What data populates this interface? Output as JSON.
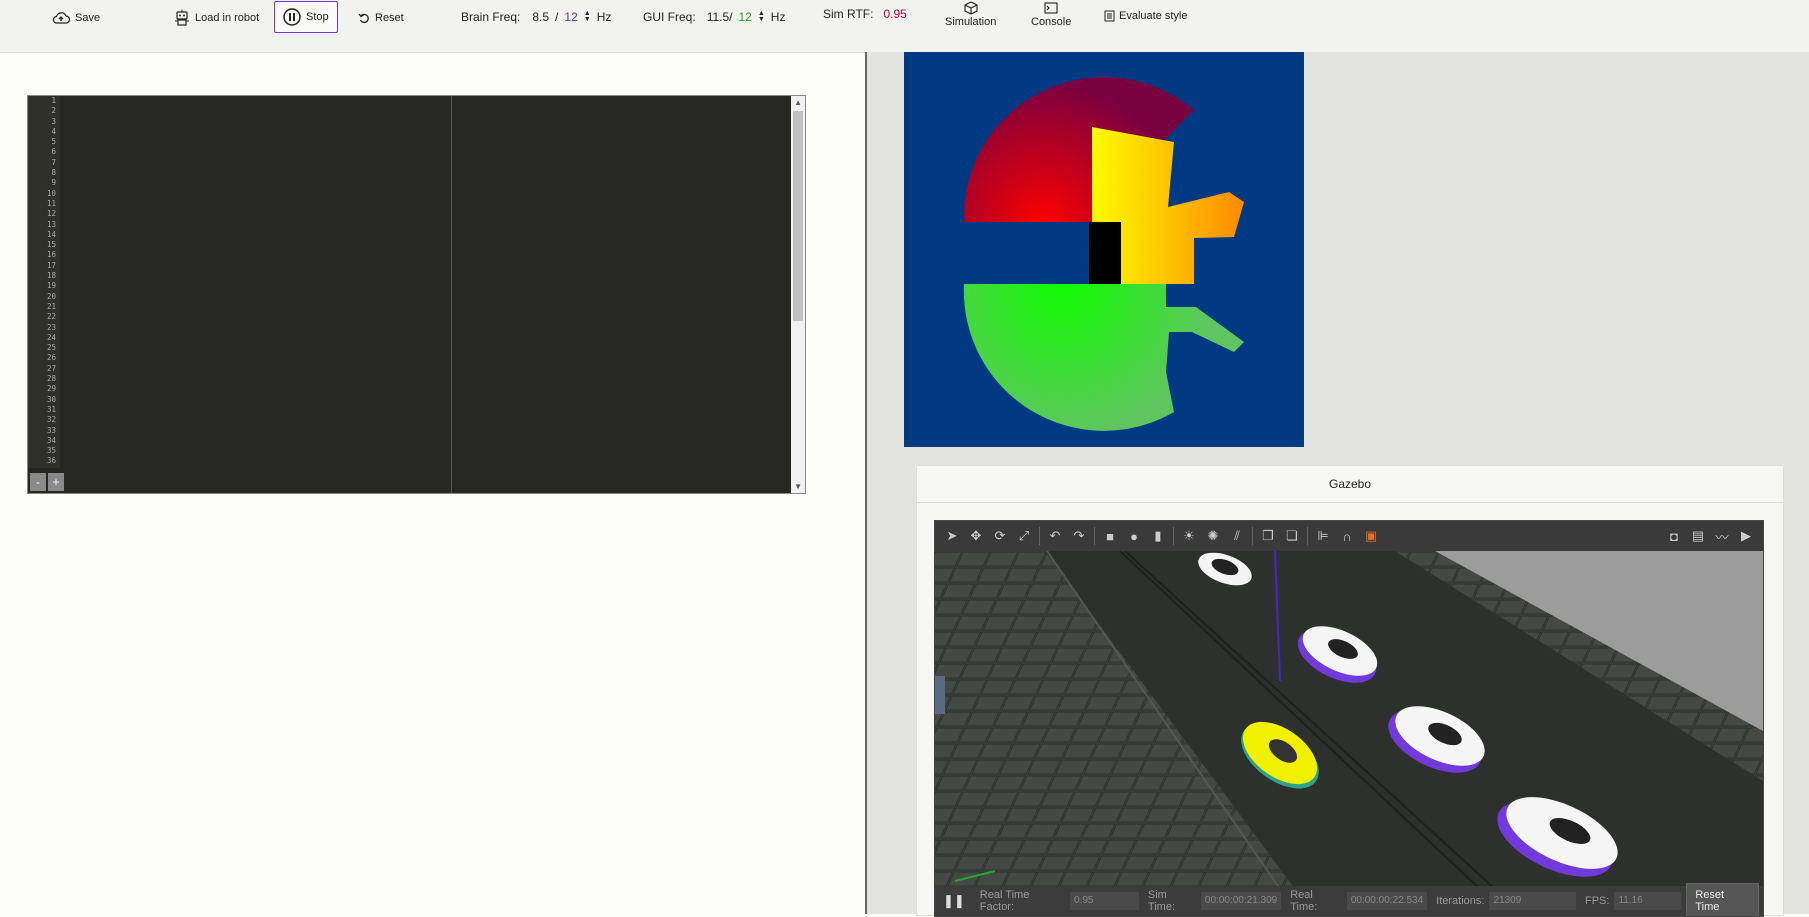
{
  "toolbar": {
    "save_label": "Save",
    "load_label": "Load in robot",
    "stop_label": "Stop",
    "reset_label": "Reset",
    "brain_freq_label": "Brain Freq:",
    "brain_freq_value": "8.5",
    "brain_freq_sep": "/",
    "brain_freq_target": "12",
    "brain_freq_unit": "Hz",
    "gui_freq_label": "GUI Freq:",
    "gui_freq_value": "11.5/",
    "gui_freq_target": "12",
    "gui_freq_unit": "Hz",
    "sim_rtf_label": "Sim RTF:",
    "sim_rtf_value": "0.95",
    "simulation_label": "Simulation",
    "console_label": "Console",
    "evaluate_label": "Evaluate style"
  },
  "editor": {
    "line_numbers": [
      "1",
      "2",
      "3",
      "4",
      "5",
      "6",
      "7",
      "8",
      "9",
      "10",
      "11",
      "12",
      "13",
      "14",
      "15",
      "16",
      "17",
      "18",
      "19",
      "20",
      "21",
      "22",
      "23",
      "24",
      "25",
      "26",
      "27",
      "28",
      "29",
      "30",
      "31",
      "32",
      "33",
      "34",
      "35",
      "36"
    ],
    "zoom_out": "-",
    "zoom_in": "+"
  },
  "gazebo": {
    "title": "Gazebo",
    "real_time_factor_label": "Real Time Factor:",
    "real_time_factor": "0.95",
    "sim_time_label": "Sim Time:",
    "sim_time": "00:00:00:21.309",
    "real_time_label": "Real Time:",
    "real_time": "00:00:00:22.534",
    "iterations_label": "Iterations:",
    "iterations": "21309",
    "fps_label": "FPS:",
    "fps": "11.16",
    "reset_time_label": "Reset Time"
  },
  "colors": {
    "accent": "#5b2ed4",
    "laser_bg": "#003a85",
    "rtf": "#b0003a",
    "gui_target": "#2a9e2a",
    "editor_bg": "#272822"
  }
}
